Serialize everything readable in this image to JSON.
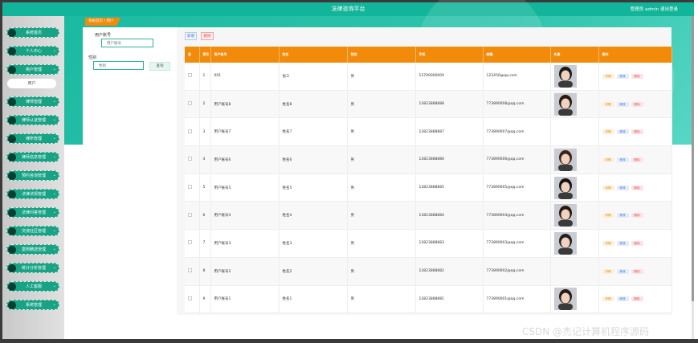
{
  "header": {
    "title": "法律咨询平台",
    "user_info": "管理员 admin  退出登录"
  },
  "breadcrumb": {
    "home": "系统首页",
    "separator": "/",
    "current": "用户"
  },
  "sidebar": {
    "items": [
      {
        "label": "系统首页",
        "has_arrow": false
      },
      {
        "label": "个人中心",
        "has_arrow": true
      },
      {
        "label": "用户管理",
        "has_arrow": true
      },
      {
        "label": "律师管理",
        "has_arrow": true
      },
      {
        "label": "律师认证管理",
        "has_arrow": true
      },
      {
        "label": "律所管理",
        "has_arrow": true
      },
      {
        "label": "律师信息管理",
        "has_arrow": true
      },
      {
        "label": "预约咨询管理",
        "has_arrow": true
      },
      {
        "label": "法律法规管理",
        "has_arrow": true
      },
      {
        "label": "法律问答管理",
        "has_arrow": true
      },
      {
        "label": "交流社区管理",
        "has_arrow": true
      },
      {
        "label": "案例精选管理",
        "has_arrow": true
      },
      {
        "label": "统计分析管理",
        "has_arrow": true
      },
      {
        "label": "人工客服",
        "has_arrow": true
      },
      {
        "label": "系统管理",
        "has_arrow": true
      }
    ],
    "submenu_label": "用户"
  },
  "search": {
    "account_label": "用户账号",
    "account_placeholder": "用户账号",
    "gender_label": "性别",
    "gender_placeholder": "性别",
    "button_label": "查询"
  },
  "toolbar": {
    "add_label": "新增",
    "delete_label": "删除"
  },
  "table": {
    "headers": [
      "选",
      "索引",
      "用户账号",
      "姓名",
      "性别",
      "手机",
      "邮箱",
      "头像",
      "操作"
    ],
    "rows": [
      {
        "index": "1",
        "account": "001",
        "name": "张三",
        "gender": "男",
        "phone": "13700000000",
        "email": "123456@qq.com",
        "has_avatar": true
      },
      {
        "index": "2",
        "account": "用户账号8",
        "name": "姓名8",
        "gender": "男",
        "phone": "13823888888",
        "email": "773890008@qq.com",
        "has_avatar": true
      },
      {
        "index": "3",
        "account": "用户账号7",
        "name": "姓名7",
        "gender": "男",
        "phone": "13823888887",
        "email": "773890007@qq.com",
        "has_avatar": false
      },
      {
        "index": "4",
        "account": "用户账号6",
        "name": "姓名6",
        "gender": "男",
        "phone": "13823888886",
        "email": "773890006@qq.com",
        "has_avatar": true
      },
      {
        "index": "5",
        "account": "用户账号5",
        "name": "姓名5",
        "gender": "男",
        "phone": "13823888885",
        "email": "773890005@qq.com",
        "has_avatar": true
      },
      {
        "index": "6",
        "account": "用户账号4",
        "name": "姓名4",
        "gender": "男",
        "phone": "13823888884",
        "email": "773890004@qq.com",
        "has_avatar": true
      },
      {
        "index": "7",
        "account": "用户账号3",
        "name": "姓名3",
        "gender": "男",
        "phone": "13823888883",
        "email": "773890003@qq.com",
        "has_avatar": true
      },
      {
        "index": "8",
        "account": "用户账号2",
        "name": "姓名2",
        "gender": "男",
        "phone": "13823888882",
        "email": "773890002@qq.com",
        "has_avatar": false
      },
      {
        "index": "9",
        "account": "用户账号1",
        "name": "姓名1",
        "gender": "男",
        "phone": "13823888881",
        "email": "773890001@qq.com",
        "has_avatar": true
      }
    ],
    "actions": {
      "detail": "详情",
      "edit": "修改",
      "delete": "删除"
    }
  },
  "watermark": "CSDN @杰记计算机程序源码",
  "colors": {
    "header": "#13b59a",
    "table_header": "#f28a0a",
    "menu": "#17a384"
  }
}
